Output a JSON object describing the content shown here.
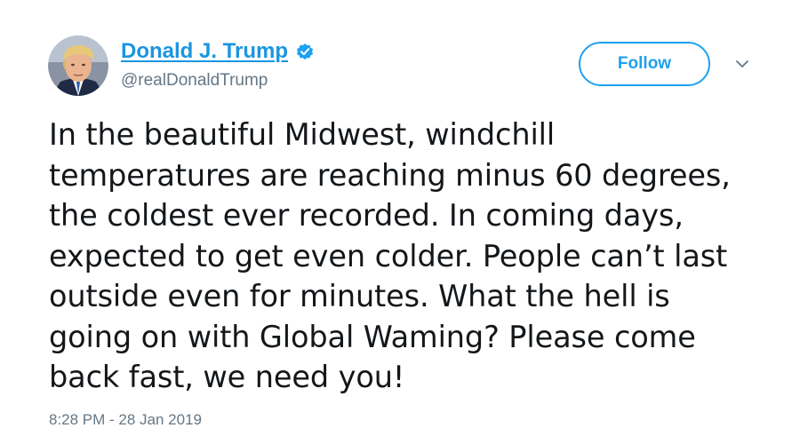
{
  "author": {
    "display_name": "Donald J. Trump",
    "handle": "@realDonaldTrump",
    "verified": true,
    "avatar_icon": "avatar-photo"
  },
  "actions": {
    "follow_label": "Follow",
    "menu_icon": "chevron-down-icon"
  },
  "tweet": {
    "lines": [
      "In the beautiful Midwest, windchill",
      "temperatures are reaching minus 60 degrees,",
      "the coldest ever recorded. In coming days,",
      "expected to get even colder. People can’t last",
      "outside even for minutes. What the hell is",
      "going on with Global Waming? Please come",
      "back fast, we need you!"
    ],
    "timestamp": "8:28 PM - 28 Jan 2019"
  },
  "colors": {
    "link_blue": "#1b95e0",
    "button_blue": "#1da1f2",
    "secondary_text": "#657786",
    "primary_text": "#14171a",
    "verified_badge": "#1da1f2"
  }
}
